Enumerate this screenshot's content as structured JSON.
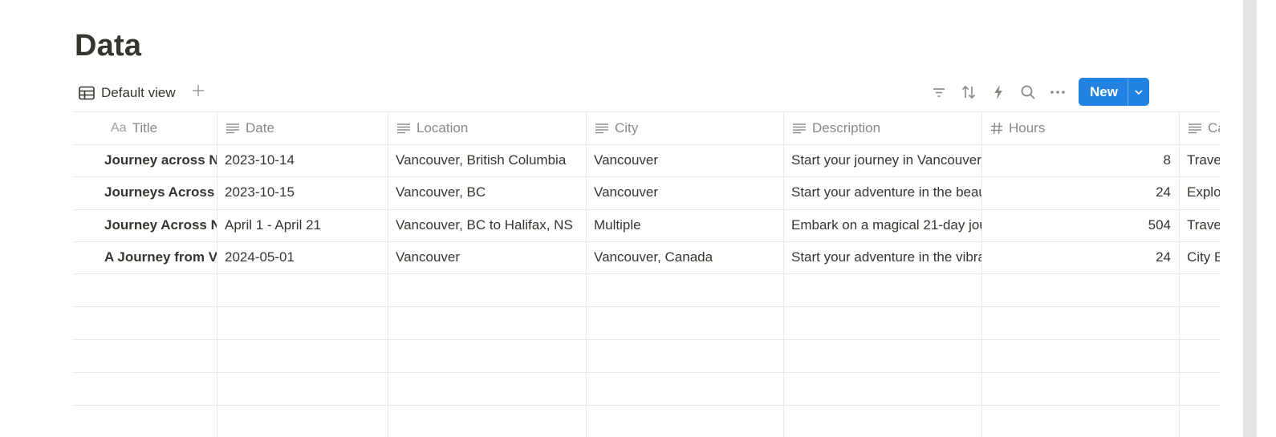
{
  "page": {
    "title": "Data"
  },
  "view": {
    "name": "Default view"
  },
  "toolbar": {
    "new_label": "New"
  },
  "icons": {
    "view": "table-icon",
    "add": "plus-icon",
    "filter": "filter-icon",
    "sort": "sort-icon",
    "automation": "lightning-icon",
    "search": "search-icon",
    "more": "more-icon",
    "caret": "chevron-down-icon"
  },
  "colors": {
    "accent": "#2383e2",
    "text": "#37352f",
    "muted": "#8a8984",
    "grid": "#e9e9e7"
  },
  "table": {
    "title_prefix": "Aa",
    "columns": [
      {
        "label": "Title",
        "type": "title"
      },
      {
        "label": "Date",
        "type": "text"
      },
      {
        "label": "Location",
        "type": "text"
      },
      {
        "label": "City",
        "type": "text"
      },
      {
        "label": "Description",
        "type": "text"
      },
      {
        "label": "Hours",
        "type": "number"
      },
      {
        "label": "Categ",
        "type": "text"
      }
    ],
    "rows": [
      [
        "Journey across No",
        "2023-10-14",
        "Vancouver, British Columbia",
        "Vancouver",
        "Start your journey in Vancouver",
        "8",
        "Travel"
      ],
      [
        "Journeys Across N",
        "2023-10-15",
        "Vancouver, BC",
        "Vancouver",
        "Start your adventure in the beau",
        "24",
        "Exploratio"
      ],
      [
        "Journey Across No",
        "April 1 - April 21",
        "Vancouver, BC to Halifax, NS",
        "Multiple",
        "Embark on a magical 21-day jou",
        "504",
        "Travel Pla"
      ],
      [
        "A Journey from Va",
        "2024-05-01",
        "Vancouver",
        "Vancouver, Canada",
        "Start your adventure in the vibra",
        "24",
        "City Explo"
      ]
    ]
  }
}
